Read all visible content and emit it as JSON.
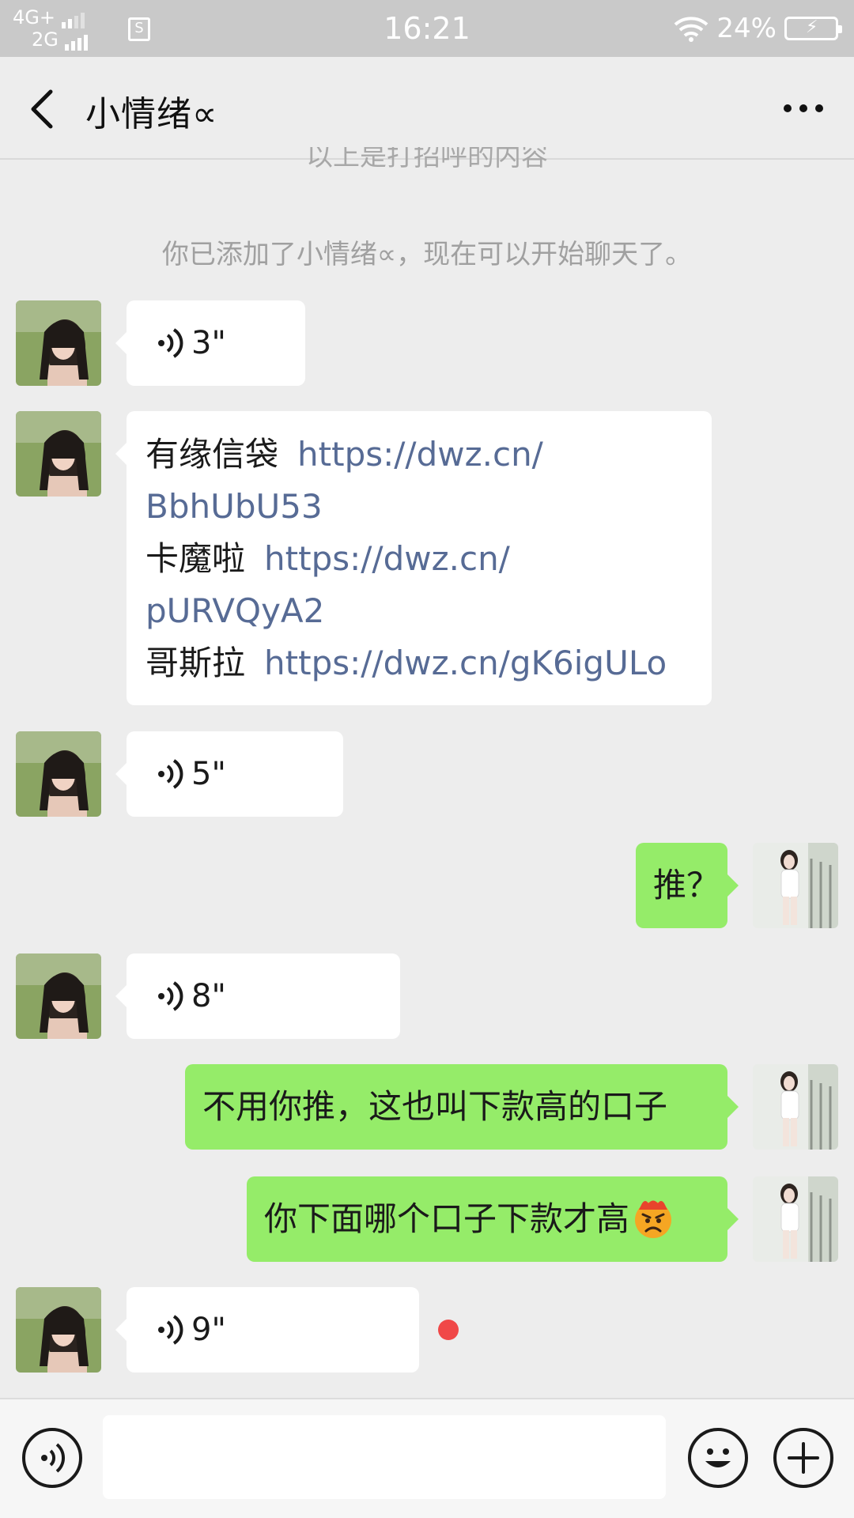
{
  "status_bar": {
    "network_top": "4G+",
    "network_bottom": "2G",
    "sim_icon": "S",
    "time": "16:21",
    "battery_percent": "24%"
  },
  "nav": {
    "title": "小情绪∝"
  },
  "system": {
    "greeting_cut": "以上是打招呼的内容",
    "added_notice": "你已添加了小情绪∝，现在可以开始聊天了。"
  },
  "messages": {
    "voice_1": "3\"",
    "links": [
      {
        "label": "有缘信袋",
        "url_line1": "https://dwz.cn/",
        "url_line2": "BbhUbU53"
      },
      {
        "label": "卡魔啦",
        "url_line1": "https://dwz.cn/",
        "url_line2": "pURVQyA2"
      },
      {
        "label": "哥斯拉",
        "url_line1": "https://dwz.cn/gK6igULo"
      }
    ],
    "voice_2": "5\"",
    "sent_1": "推？",
    "voice_3": "8\"",
    "sent_2": "不用你推，这也叫下款高的口子",
    "sent_3": "你下面哪个口子下款才高",
    "voice_4": "9\""
  },
  "colors": {
    "sent_bubble": "#95ec69",
    "received_bubble": "#ffffff",
    "link": "#576b95",
    "unread_dot": "#f04848"
  },
  "icons": {
    "back": "back-arrow-icon",
    "more": "more-icon",
    "voice": "voice-wave-icon",
    "emoji": "emoji-icon",
    "plus": "plus-icon",
    "angry_emoji": "angry-face-emoji"
  }
}
